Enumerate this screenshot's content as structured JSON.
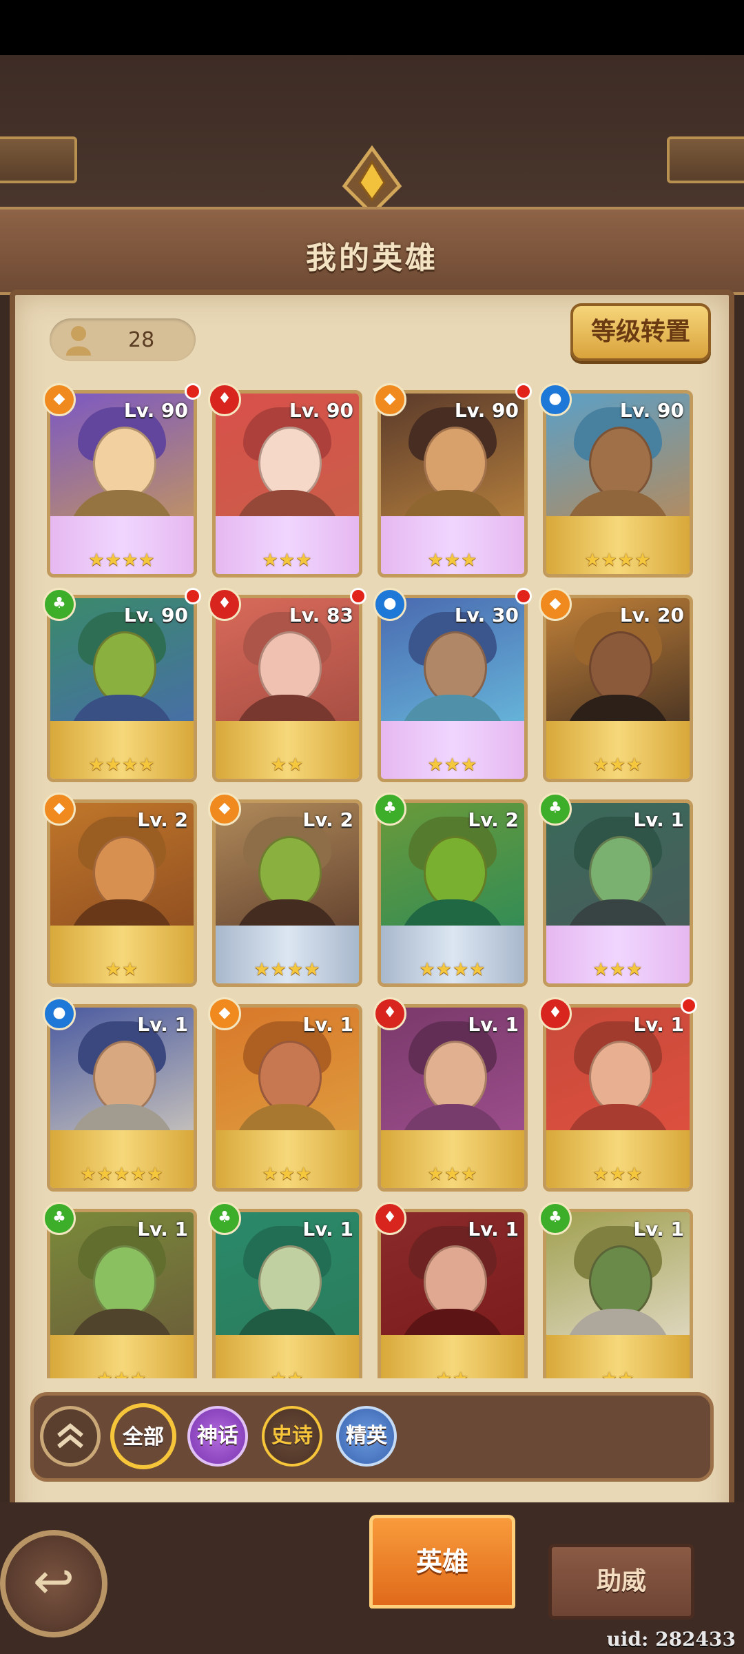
{
  "header": {
    "title": "我的英雄"
  },
  "hero_count": "28",
  "level_reset_label": "等级转置",
  "heroes": [
    {
      "level": "Lv. 90",
      "element": "orange",
      "stars": "★★★★",
      "new": true
    },
    {
      "level": "Lv. 90",
      "element": "red",
      "stars": "★★★",
      "new": false
    },
    {
      "level": "Lv. 90",
      "element": "orange",
      "stars": "★★★",
      "new": true
    },
    {
      "level": "Lv. 90",
      "element": "blue",
      "stars": "★★★★",
      "new": false
    },
    {
      "level": "Lv. 90",
      "element": "green",
      "stars": "★★★★",
      "new": true
    },
    {
      "level": "Lv. 83",
      "element": "red",
      "stars": "★★",
      "new": true
    },
    {
      "level": "Lv. 30",
      "element": "blue",
      "stars": "★★★",
      "new": true
    },
    {
      "level": "Lv. 20",
      "element": "orange",
      "stars": "★★★",
      "new": false
    },
    {
      "level": "Lv. 2",
      "element": "orange",
      "stars": "★★",
      "new": false
    },
    {
      "level": "Lv. 2",
      "element": "orange",
      "stars": "★★★★",
      "new": false
    },
    {
      "level": "Lv. 2",
      "element": "green",
      "stars": "★★★★",
      "new": false
    },
    {
      "level": "Lv. 1",
      "element": "green",
      "stars": "★★★",
      "new": false
    },
    {
      "level": "Lv. 1",
      "element": "blue",
      "stars": "★★★★★",
      "new": false
    },
    {
      "level": "Lv. 1",
      "element": "orange",
      "stars": "★★★",
      "new": false
    },
    {
      "level": "Lv. 1",
      "element": "red",
      "stars": "★★★",
      "new": false
    },
    {
      "level": "Lv. 1",
      "element": "red",
      "stars": "★★★",
      "new": true
    },
    {
      "level": "Lv. 1",
      "element": "green",
      "stars": "★★★",
      "new": false
    },
    {
      "level": "Lv. 1",
      "element": "green",
      "stars": "★★",
      "new": false
    },
    {
      "level": "Lv. 1",
      "element": "red",
      "stars": "★★",
      "new": false
    },
    {
      "level": "Lv. 1",
      "element": "green",
      "stars": "★★",
      "new": false
    }
  ],
  "filters": {
    "all": "全部",
    "mythic": "神话",
    "epic": "史诗",
    "elite": "精英"
  },
  "tabs": {
    "heroes": "英雄",
    "support": "助威"
  },
  "uid": "uid: 282433",
  "colors": {
    "orange": "#f08a1e",
    "red": "#d8261e",
    "blue": "#1e78d8",
    "green": "#3cae2a"
  }
}
